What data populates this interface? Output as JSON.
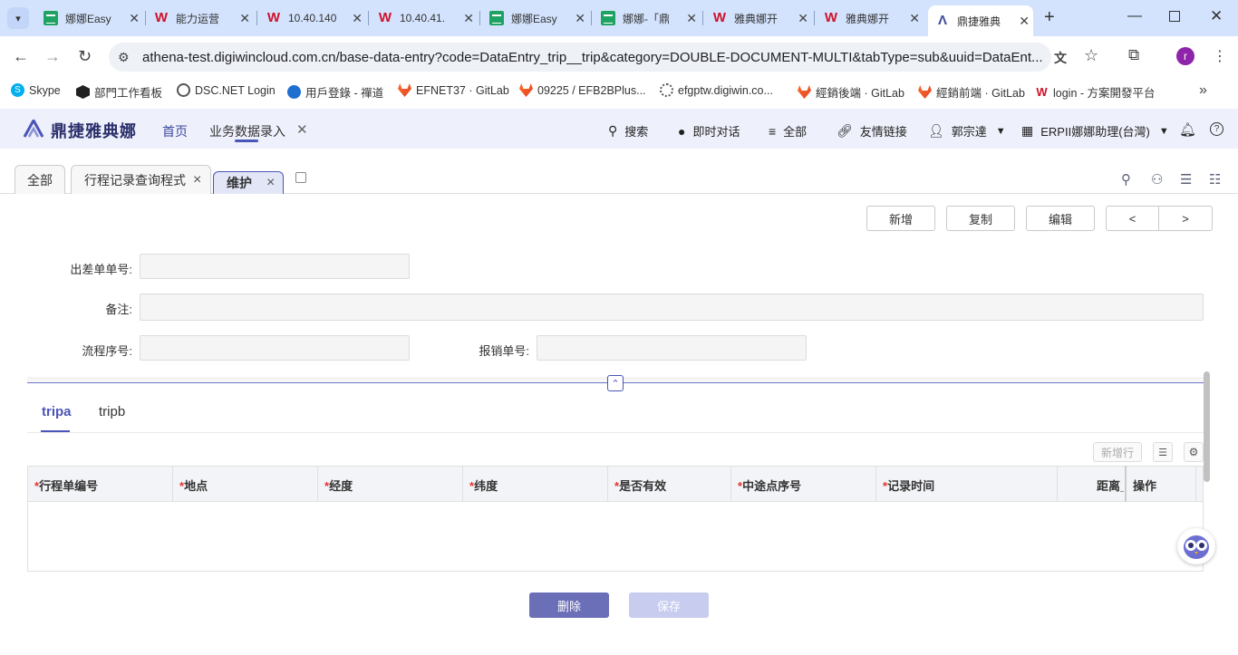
{
  "browser": {
    "tabs": [
      {
        "title": "娜娜Easy",
        "icon": "sheets-icon"
      },
      {
        "title": "能力运营",
        "icon": "w-brand-icon"
      },
      {
        "title": "10.40.140",
        "icon": "w-brand-icon"
      },
      {
        "title": "10.40.41.",
        "icon": "w-brand-icon"
      },
      {
        "title": "娜娜Easy",
        "icon": "sheets-icon"
      },
      {
        "title": "娜娜-「鼎",
        "icon": "sheets-icon"
      },
      {
        "title": "雅典娜开",
        "icon": "w-brand-icon"
      },
      {
        "title": "雅典娜开",
        "icon": "w-brand-icon"
      },
      {
        "title": "鼎捷雅典",
        "icon": "athena-icon"
      }
    ],
    "url": "athena-test.digiwincloud.com.cn/base-data-entry?code=DataEntry_trip__trip&category=DOUBLE-DOCUMENT-MULTI&tabType=sub&uuid=DataEnt...",
    "profile_initial": "r",
    "bookmarks": [
      {
        "label": "Skype"
      },
      {
        "label": "部門工作看板"
      },
      {
        "label": "DSC.NET Login"
      },
      {
        "label": "用戶登錄 - 禪道"
      },
      {
        "label": "EFNET37 · GitLab"
      },
      {
        "label": "09225 / EFB2BPlus..."
      },
      {
        "label": "efgptw.digiwin.co..."
      },
      {
        "label": "經銷後端 · GitLab"
      },
      {
        "label": "經銷前端 · GitLab"
      },
      {
        "label": "login - 方案開發平台"
      }
    ]
  },
  "app": {
    "logo": "鼎捷雅典娜",
    "nav": {
      "home": "首页",
      "current": "业务数据录入"
    },
    "header": {
      "search": "搜索",
      "chat": "即时对话",
      "all": "全部",
      "links": "友情链接",
      "user": "郭宗達",
      "tenant": "ERPII娜娜助理(台灣)"
    },
    "page_tabs": [
      {
        "label": "全部"
      },
      {
        "label": "行程记录查询程式"
      },
      {
        "label": "维护"
      }
    ],
    "actions": {
      "add": "新增",
      "copy": "复制",
      "edit": "编辑",
      "prev": "<",
      "next": ">"
    },
    "form": {
      "trip_no_label": "出差单单号:",
      "remark_label": "备注:",
      "flow_no_label": "流程序号:",
      "reimburse_no_label": "报销单号:"
    },
    "sub_tabs": [
      {
        "label": "tripa"
      },
      {
        "label": "tripb"
      }
    ],
    "add_row": "新增行",
    "table": {
      "columns": [
        {
          "label": "行程单编号",
          "required": "*"
        },
        {
          "label": "地点",
          "required": "*"
        },
        {
          "label": "经度",
          "required": "*"
        },
        {
          "label": "纬度",
          "required": "*"
        },
        {
          "label": "是否有效",
          "required": "*"
        },
        {
          "label": "中途点序号",
          "required": "*"
        },
        {
          "label": "记录时间",
          "required": "*"
        },
        {
          "label": "距离_",
          "required": ""
        },
        {
          "label": "操作",
          "required": ""
        }
      ]
    },
    "footer": {
      "delete": "删除",
      "save": "保存"
    },
    "colors": {
      "primary": "#4a55b8",
      "delete_btn": "#6b6fb8",
      "save_btn_disabled": "#c8ccef",
      "required": "#e5322d"
    }
  }
}
